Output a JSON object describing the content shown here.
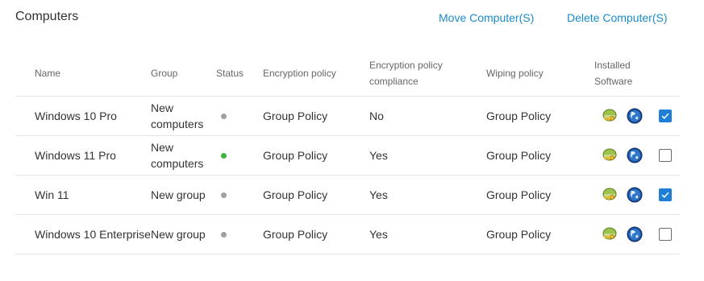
{
  "header": {
    "title": "Computers",
    "move_label": "Move Computer(S)",
    "delete_label": "Delete Computer(S)"
  },
  "columns": {
    "name": "Name",
    "group": "Group",
    "status": "Status",
    "encryption_policy": "Encryption policy",
    "compliance_line1": "Encryption policy",
    "compliance_line2": "compliance",
    "wiping_policy": "Wiping policy",
    "installed_line1": "Installed",
    "installed_line2": "Software"
  },
  "rows": [
    {
      "name": "Windows 10 Pro",
      "group_line1": "New",
      "group_line2": "computers",
      "status_color": "#a0a0a0",
      "encryption_policy": "Group Policy",
      "compliance": "No",
      "wiping_policy": "Group Policy",
      "checked": true
    },
    {
      "name": "Windows 11 Pro",
      "group_line1": "New",
      "group_line2": "computers",
      "status_color": "#3db33d",
      "encryption_policy": "Group Policy",
      "compliance": "Yes",
      "wiping_policy": "Group Policy",
      "checked": false
    },
    {
      "name": "Win 11",
      "group_line1": "New group",
      "group_line2": "",
      "status_color": "#a0a0a0",
      "encryption_policy": "Group Policy",
      "compliance": "Yes",
      "wiping_policy": "Group Policy",
      "checked": true
    },
    {
      "name": "Windows 10 Enterprise",
      "group_line1": "New group",
      "group_line2": "",
      "status_color": "#a0a0a0",
      "encryption_policy": "Group Policy",
      "compliance": "Yes",
      "wiping_policy": "Group Policy",
      "checked": false
    }
  ],
  "installed_software_icons": [
    "drive-key-icon",
    "globe-icon"
  ],
  "colors": {
    "accent": "#1a8bc9",
    "checkbox_checked": "#1f7fd6"
  }
}
